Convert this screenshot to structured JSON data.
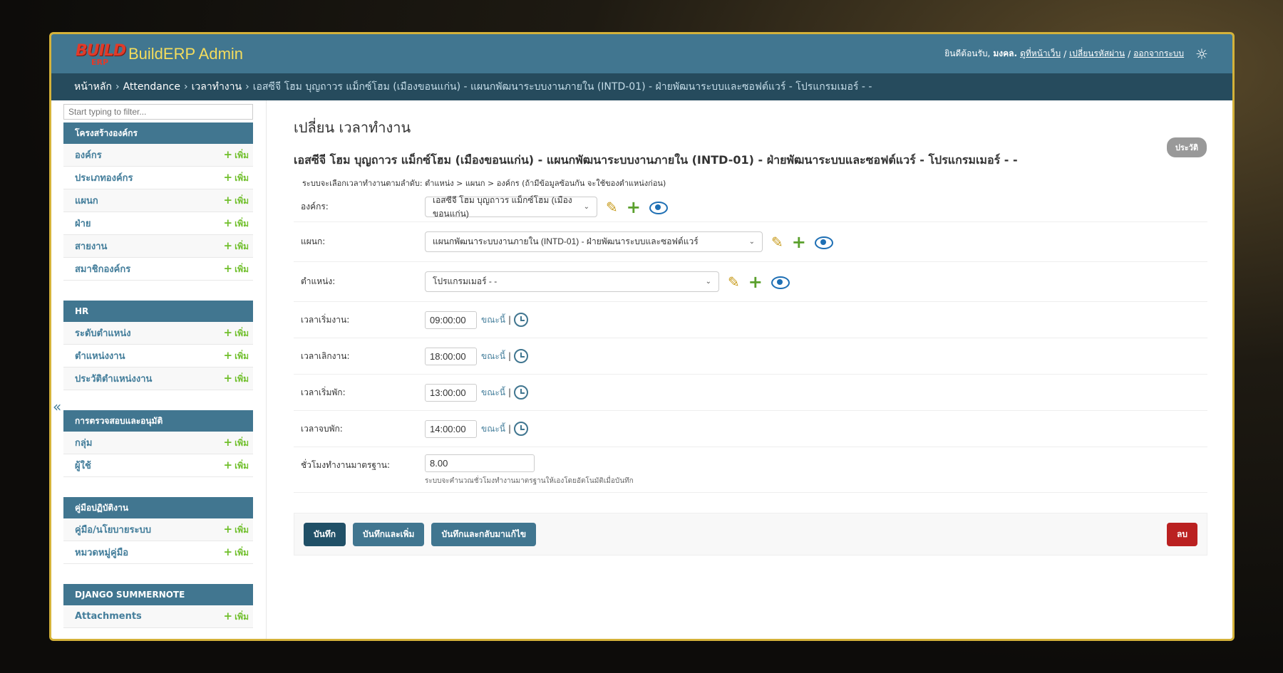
{
  "header": {
    "logo_text": "BUILD",
    "logo_sub": "ERP",
    "brand": "BuildERP Admin",
    "welcome": "ยินดีต้อนรับ,",
    "username": "มงคล.",
    "view_site": "ดูที่หน้าเว็บ",
    "change_password": "เปลี่ยนรหัสผ่าน",
    "logout": "ออกจากระบบ",
    "sep": "/"
  },
  "breadcrumbs": {
    "home": "หน้าหลัก",
    "app": "Attendance",
    "model": "เวลาทำงาน",
    "current": "เอสซีจี โฮม บุญถาวร แม็กซ์โฮม (เมืองขอนแก่น) - แผนกพัฒนาระบบงานภายใน (INTD-01) - ฝ่ายพัฒนาระบบและซอฟต์แวร์ - โปรแกรมเมอร์ - -",
    "sep": "›"
  },
  "sidebar": {
    "filter_placeholder": "Start typing to filter...",
    "add_label": "เพิ่ม",
    "collapse_glyph": "«",
    "modules": [
      {
        "caption": "โครงสร้างองค์กร",
        "items": [
          "องค์กร",
          "ประเภทองค์กร",
          "แผนก",
          "ฝ่าย",
          "สายงาน",
          "สมาชิกองค์กร"
        ]
      },
      {
        "caption": "HR",
        "items": [
          "ระดับตำแหน่ง",
          "ตำแหน่งงาน",
          "ประวัติตำแหน่งงาน"
        ]
      },
      {
        "caption": "การตรวจสอบและอนุมัติ",
        "items": [
          "กลุ่ม",
          "ผู้ใช้"
        ]
      },
      {
        "caption": "คู่มือปฏิบัติงาน",
        "items": [
          "คู่มือ/นโยบายระบบ",
          "หมวดหมู่คู่มือ"
        ]
      },
      {
        "caption": "DJANGO SUMMERNOTE",
        "items": [
          "Attachments"
        ]
      }
    ]
  },
  "content": {
    "page_title": "เปลี่ยน เวลาทำงาน",
    "history": "ประวัติ",
    "object_title": "เอสซีจี โฮม บุญถาวร แม็กซ์โฮม (เมืองขอนแก่น) - แผนกพัฒนาระบบงานภายใน (INTD-01) - ฝ่ายพัฒนาระบบและซอฟต์แวร์ - โปรแกรมเมอร์ - -",
    "help_top": "ระบบจะเลือกเวลาทำงานตามลำดับ: ตำแหน่ง > แผนก > องค์กร (ถ้ามีข้อมูลซ้อนกัน จะใช้ของตำแหน่งก่อน)",
    "org_label": "องค์กร:",
    "org_value": "เอสซีจี โฮม บุญถาวร แม็กซ์โฮม (เมืองขอนแก่น)",
    "dept_label": "แผนก:",
    "dept_value": "แผนกพัฒนาระบบงานภายใน (INTD-01) - ฝ่ายพัฒนาระบบและซอฟต์แวร์",
    "pos_label": "ตำแหน่ง:",
    "pos_value": "โปรแกรมเมอร์ - -",
    "now_label": "ขณะนี้",
    "pipe": "|",
    "times": [
      {
        "label": "เวลาเริ่มงาน:",
        "value": "09:00:00"
      },
      {
        "label": "เวลาเลิกงาน:",
        "value": "18:00:00"
      },
      {
        "label": "เวลาเริ่มพัก:",
        "value": "13:00:00"
      },
      {
        "label": "เวลาจบพัก:",
        "value": "14:00:00"
      }
    ],
    "hours_label": "ชั่วโมงทำงานมาตรฐาน:",
    "hours_value": "8.00",
    "hours_help": "ระบบจะคำนวณชั่วโมงทำงานมาตรฐานให้เองโดยอัตโนมัติเมื่อบันทึก"
  },
  "buttons": {
    "save": "บันทึก",
    "save_add": "บันทึกและเพิ่ม",
    "save_continue": "บันทึกและกลับมาแก้ไข",
    "delete": "ลบ"
  },
  "colors": {
    "header": "#417690",
    "breadcrumbs": "#264b5d",
    "brand": "#f5dd5d",
    "add": "#70bf2b",
    "delete": "#ba2121",
    "frame": "#d4b23a"
  }
}
